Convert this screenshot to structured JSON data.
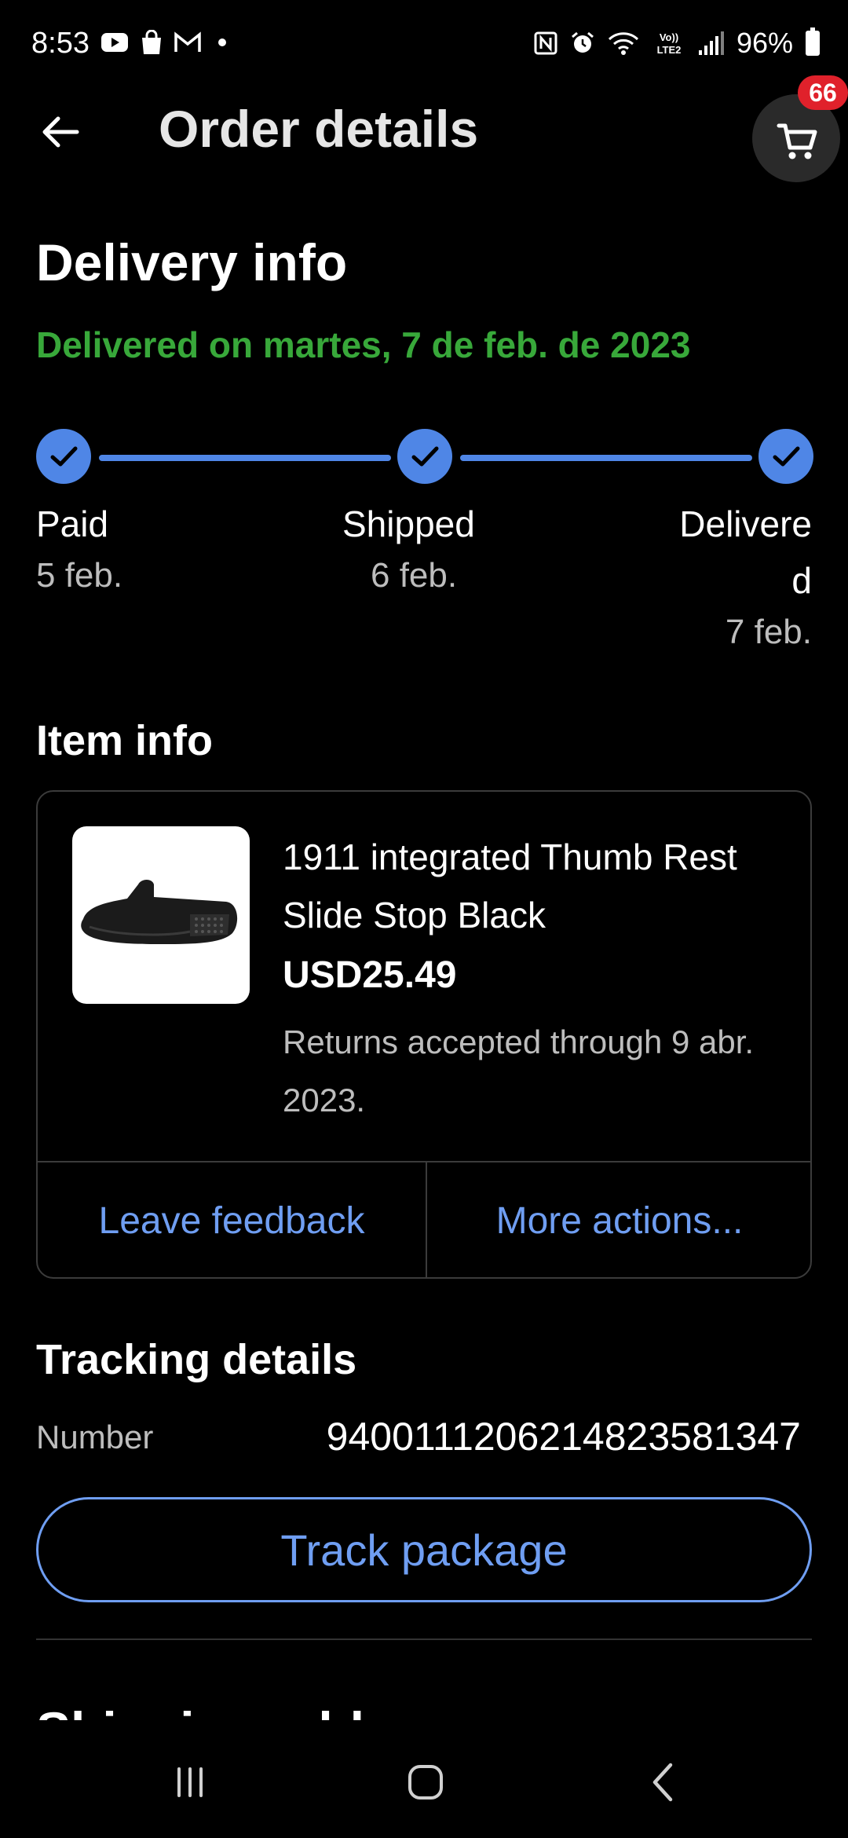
{
  "status_bar": {
    "time": "8:53",
    "battery": "96%",
    "icons": [
      "youtube-icon",
      "shopping-bag-icon",
      "gmail-icon",
      "nfc-icon",
      "alarm-icon",
      "wifi-icon",
      "volte-icon",
      "signal-icon",
      "battery-icon"
    ]
  },
  "header": {
    "title": "Order details",
    "cart_badge": "66"
  },
  "delivery": {
    "heading": "Delivery info",
    "status": "Delivered on martes, 7 de feb. de 2023",
    "accent_color": "#38a83a",
    "progress_color": "#4f86e6",
    "steps": [
      {
        "label": "Paid",
        "date": "5 feb."
      },
      {
        "label": "Shipped",
        "date": "6 feb."
      },
      {
        "label": "Delivere",
        "label_wrap": "d",
        "date": "7 feb."
      }
    ]
  },
  "item": {
    "heading": "Item info",
    "title": "1911 integrated Thumb Rest Slide Stop Black",
    "price": "USD25.49",
    "returns": "Returns accepted through 9 abr. 2023.",
    "actions": {
      "feedback": "Leave feedback",
      "more": "More actions..."
    }
  },
  "tracking": {
    "heading": "Tracking details",
    "number_label": "Number",
    "number": "9400111206214823581347",
    "track_button": "Track package"
  },
  "shipping": {
    "heading": "Shipping address"
  }
}
